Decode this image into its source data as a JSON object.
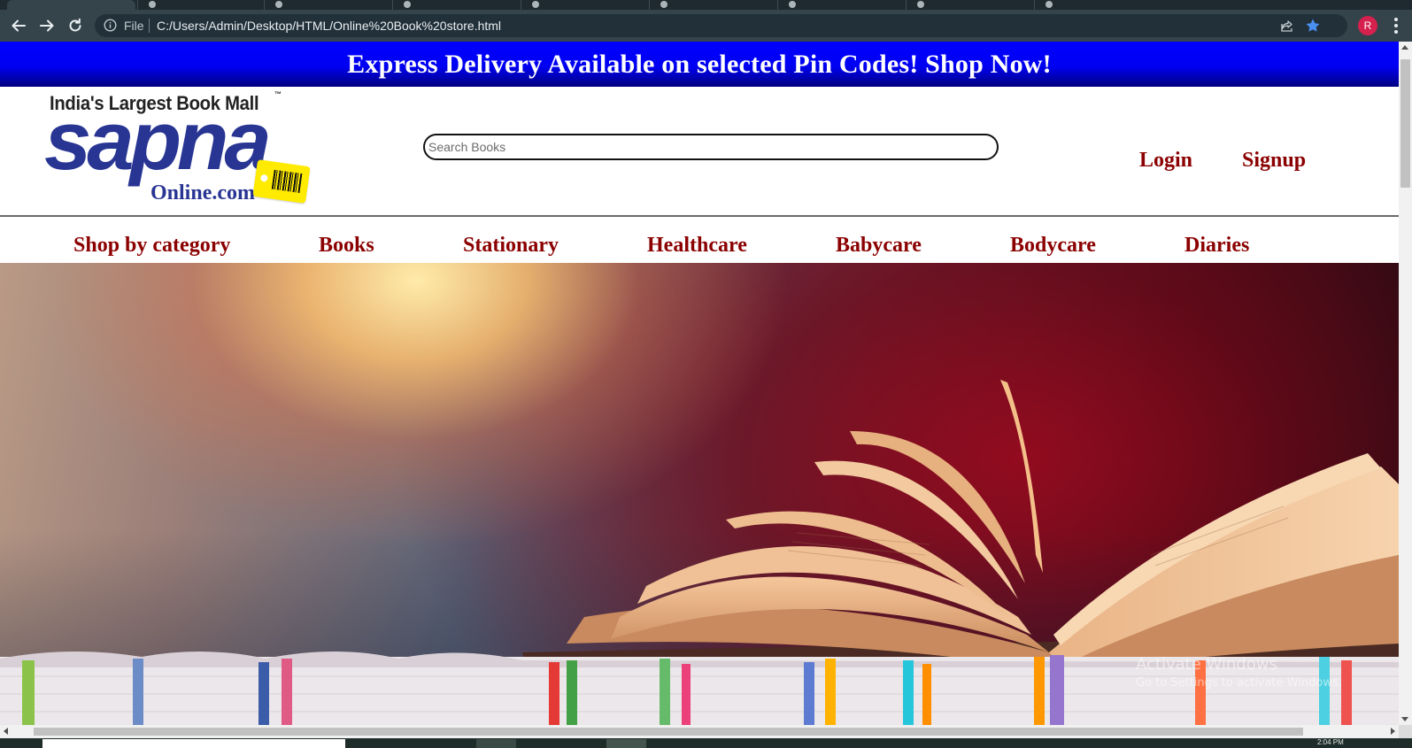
{
  "browser": {
    "tab_count": 9,
    "url_scheme_label": "File",
    "url": "C:/Users/Admin/Desktop/HTML/Online%20Book%20store.html",
    "profile_initial": "R",
    "icons": [
      "back-arrow-icon",
      "forward-arrow-icon",
      "reload-icon",
      "info-icon",
      "share-icon",
      "star-icon",
      "kebab-menu-icon"
    ],
    "colors": {
      "toolbar": "#35444b",
      "tabstrip": "#1e2a30",
      "avatar": "#d6204d",
      "star": "#4a90f0"
    }
  },
  "promo": {
    "text": "Express Delivery Available on selected Pin Codes! Shop Now!"
  },
  "logo": {
    "tagline": "India's Largest Book Mall",
    "trademark": "™",
    "wordmark": "sapna",
    "domain": "Online.com"
  },
  "search": {
    "placeholder": "Search Books"
  },
  "auth": {
    "login": "Login",
    "signup": "Signup"
  },
  "categories": [
    "Shop by category",
    "Books",
    "Stationary",
    "Healthcare",
    "Babycare",
    "Bodycare",
    "Diaries"
  ],
  "watermark": {
    "title": "Activate Windows",
    "subtitle": "Go to Settings to activate Windows."
  },
  "taskbar": {
    "clock": "2:04 PM"
  },
  "colors": {
    "promo_blue": "#0000ff",
    "link_maroon": "#8b0000",
    "logo_blue": "#283593",
    "logo_tag_yellow": "#ffeb00"
  }
}
